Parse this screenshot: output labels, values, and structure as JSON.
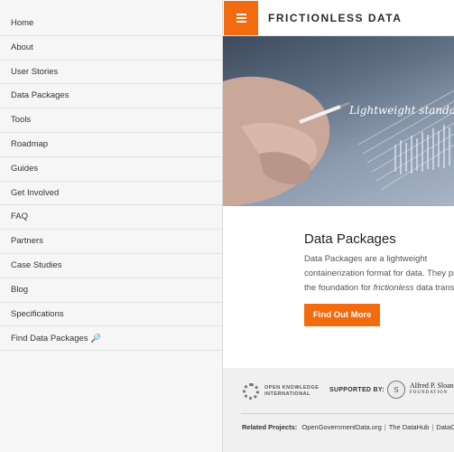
{
  "sidebar": {
    "items": [
      {
        "label": "Home"
      },
      {
        "label": "About"
      },
      {
        "label": "User Stories"
      },
      {
        "label": "Data Packages"
      },
      {
        "label": "Tools"
      },
      {
        "label": "Roadmap"
      },
      {
        "label": "Guides"
      },
      {
        "label": "Get Involved"
      },
      {
        "label": "FAQ"
      },
      {
        "label": "Partners"
      },
      {
        "label": "Case Studies"
      },
      {
        "label": "Blog"
      },
      {
        "label": "Specifications"
      },
      {
        "label": "Find Data Packages",
        "icon": "magnifier-icon"
      }
    ]
  },
  "header": {
    "brand": "FRICTIONLESS DATA",
    "menu_icon": "hamburger-icon",
    "accent_color": "#f26b0f"
  },
  "hero": {
    "tagline": "Lightweight standards and tooling"
  },
  "feature": {
    "title": "Data Packages",
    "desc_part1": "Data Packages are a lightweight containerization format for data. They provide the foundation for ",
    "desc_em": "frictionless",
    "desc_part2": " data transport.",
    "cta_label": "Find Out More"
  },
  "footer": {
    "okfn_line1": "OPEN KNOWLEDGE",
    "okfn_line2": "INTERNATIONAL",
    "supported_by": "SUPPORTED BY:",
    "sloan_seal": "S",
    "sloan_name": "Alfred P. Sloan",
    "sloan_sub": "FOUNDATION",
    "related_label": "Related Projects:",
    "related_links": [
      "OpenGovernmentData.org",
      "The DataHub",
      "DataC"
    ]
  }
}
